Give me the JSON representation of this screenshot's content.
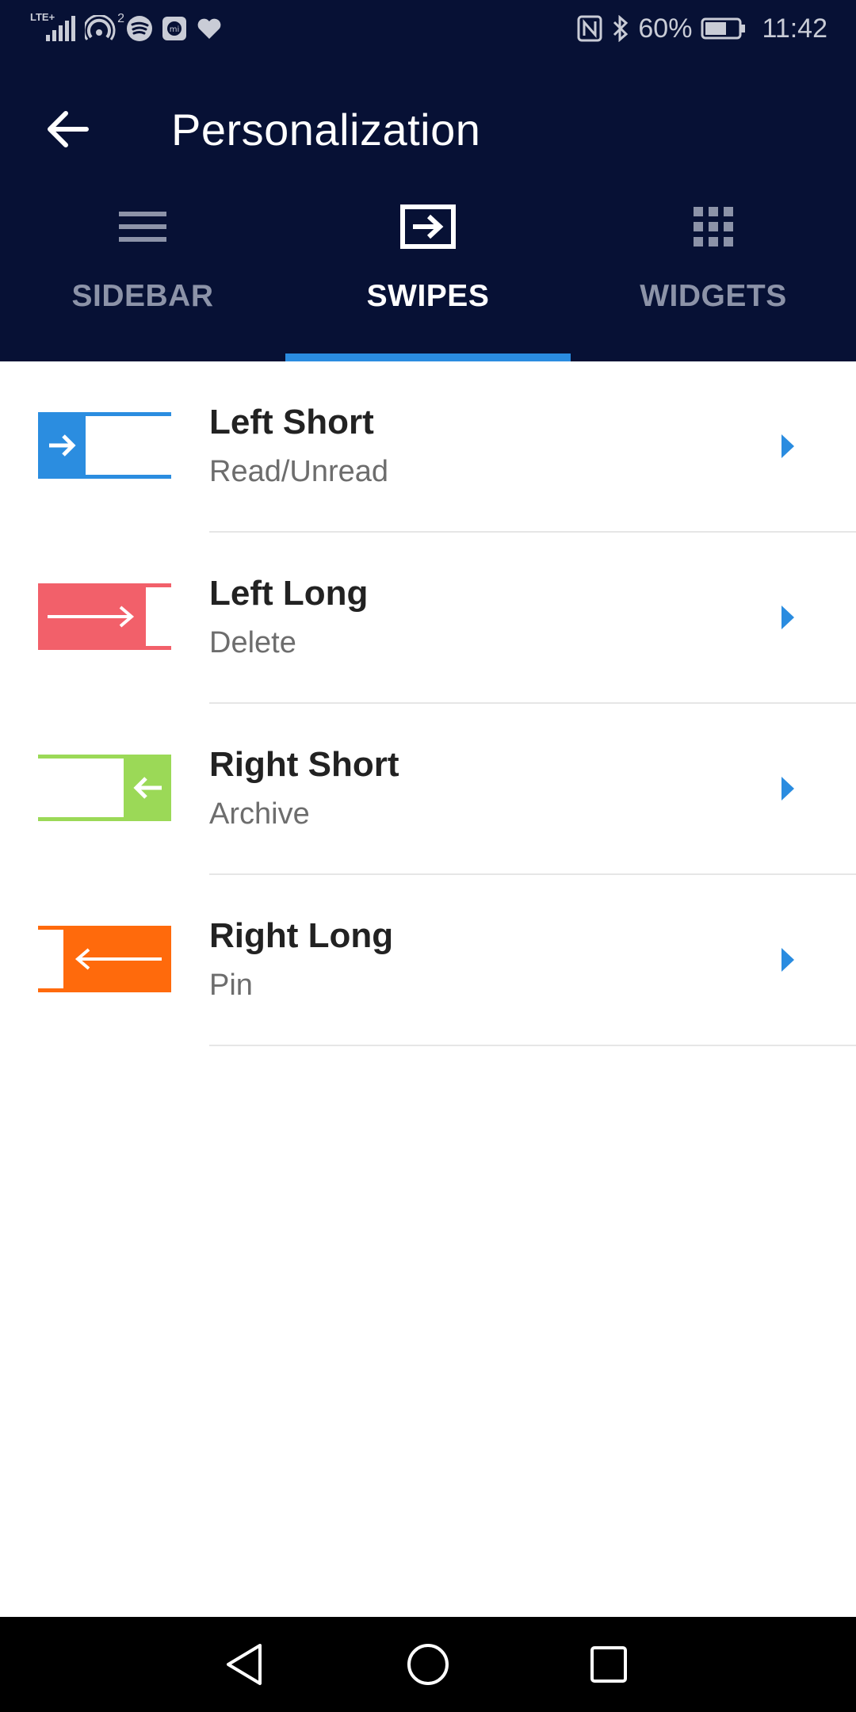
{
  "status_bar": {
    "network_label": "LTE+",
    "hotspot_count": "2",
    "battery_percent": "60%",
    "time": "11:42",
    "icons": [
      "signal-icon",
      "hotspot-icon",
      "spotify-icon",
      "mi-icon",
      "heart-icon",
      "nfc-icon",
      "bluetooth-icon",
      "battery-icon"
    ]
  },
  "app_bar": {
    "title": "Personalization",
    "back_icon": "arrow-left-icon"
  },
  "tabs": [
    {
      "label": "SIDEBAR",
      "icon": "menu-lines-icon",
      "active": false
    },
    {
      "label": "SWIPES",
      "icon": "swipe-box-arrow-icon",
      "active": true
    },
    {
      "label": "WIDGETS",
      "icon": "grid-dots-icon",
      "active": false
    }
  ],
  "swipes": [
    {
      "title": "Left Short",
      "action": "Read/Unread",
      "color": "#2b8de0",
      "icon": "swipe-left-short-icon"
    },
    {
      "title": "Left Long",
      "action": "Delete",
      "color": "#f2606a",
      "icon": "swipe-left-long-icon"
    },
    {
      "title": "Right Short",
      "action": "Archive",
      "color": "#9bd957",
      "icon": "swipe-right-short-icon"
    },
    {
      "title": "Right Long",
      "action": "Pin",
      "color": "#ff6a0c",
      "icon": "swipe-right-long-icon"
    }
  ],
  "colors": {
    "header_bg": "#071135",
    "accent": "#2a8ce0",
    "chevron": "#2a8ce0"
  },
  "nav_bar": {
    "icons": [
      "back-triangle-icon",
      "home-circle-icon",
      "recents-square-icon"
    ]
  }
}
